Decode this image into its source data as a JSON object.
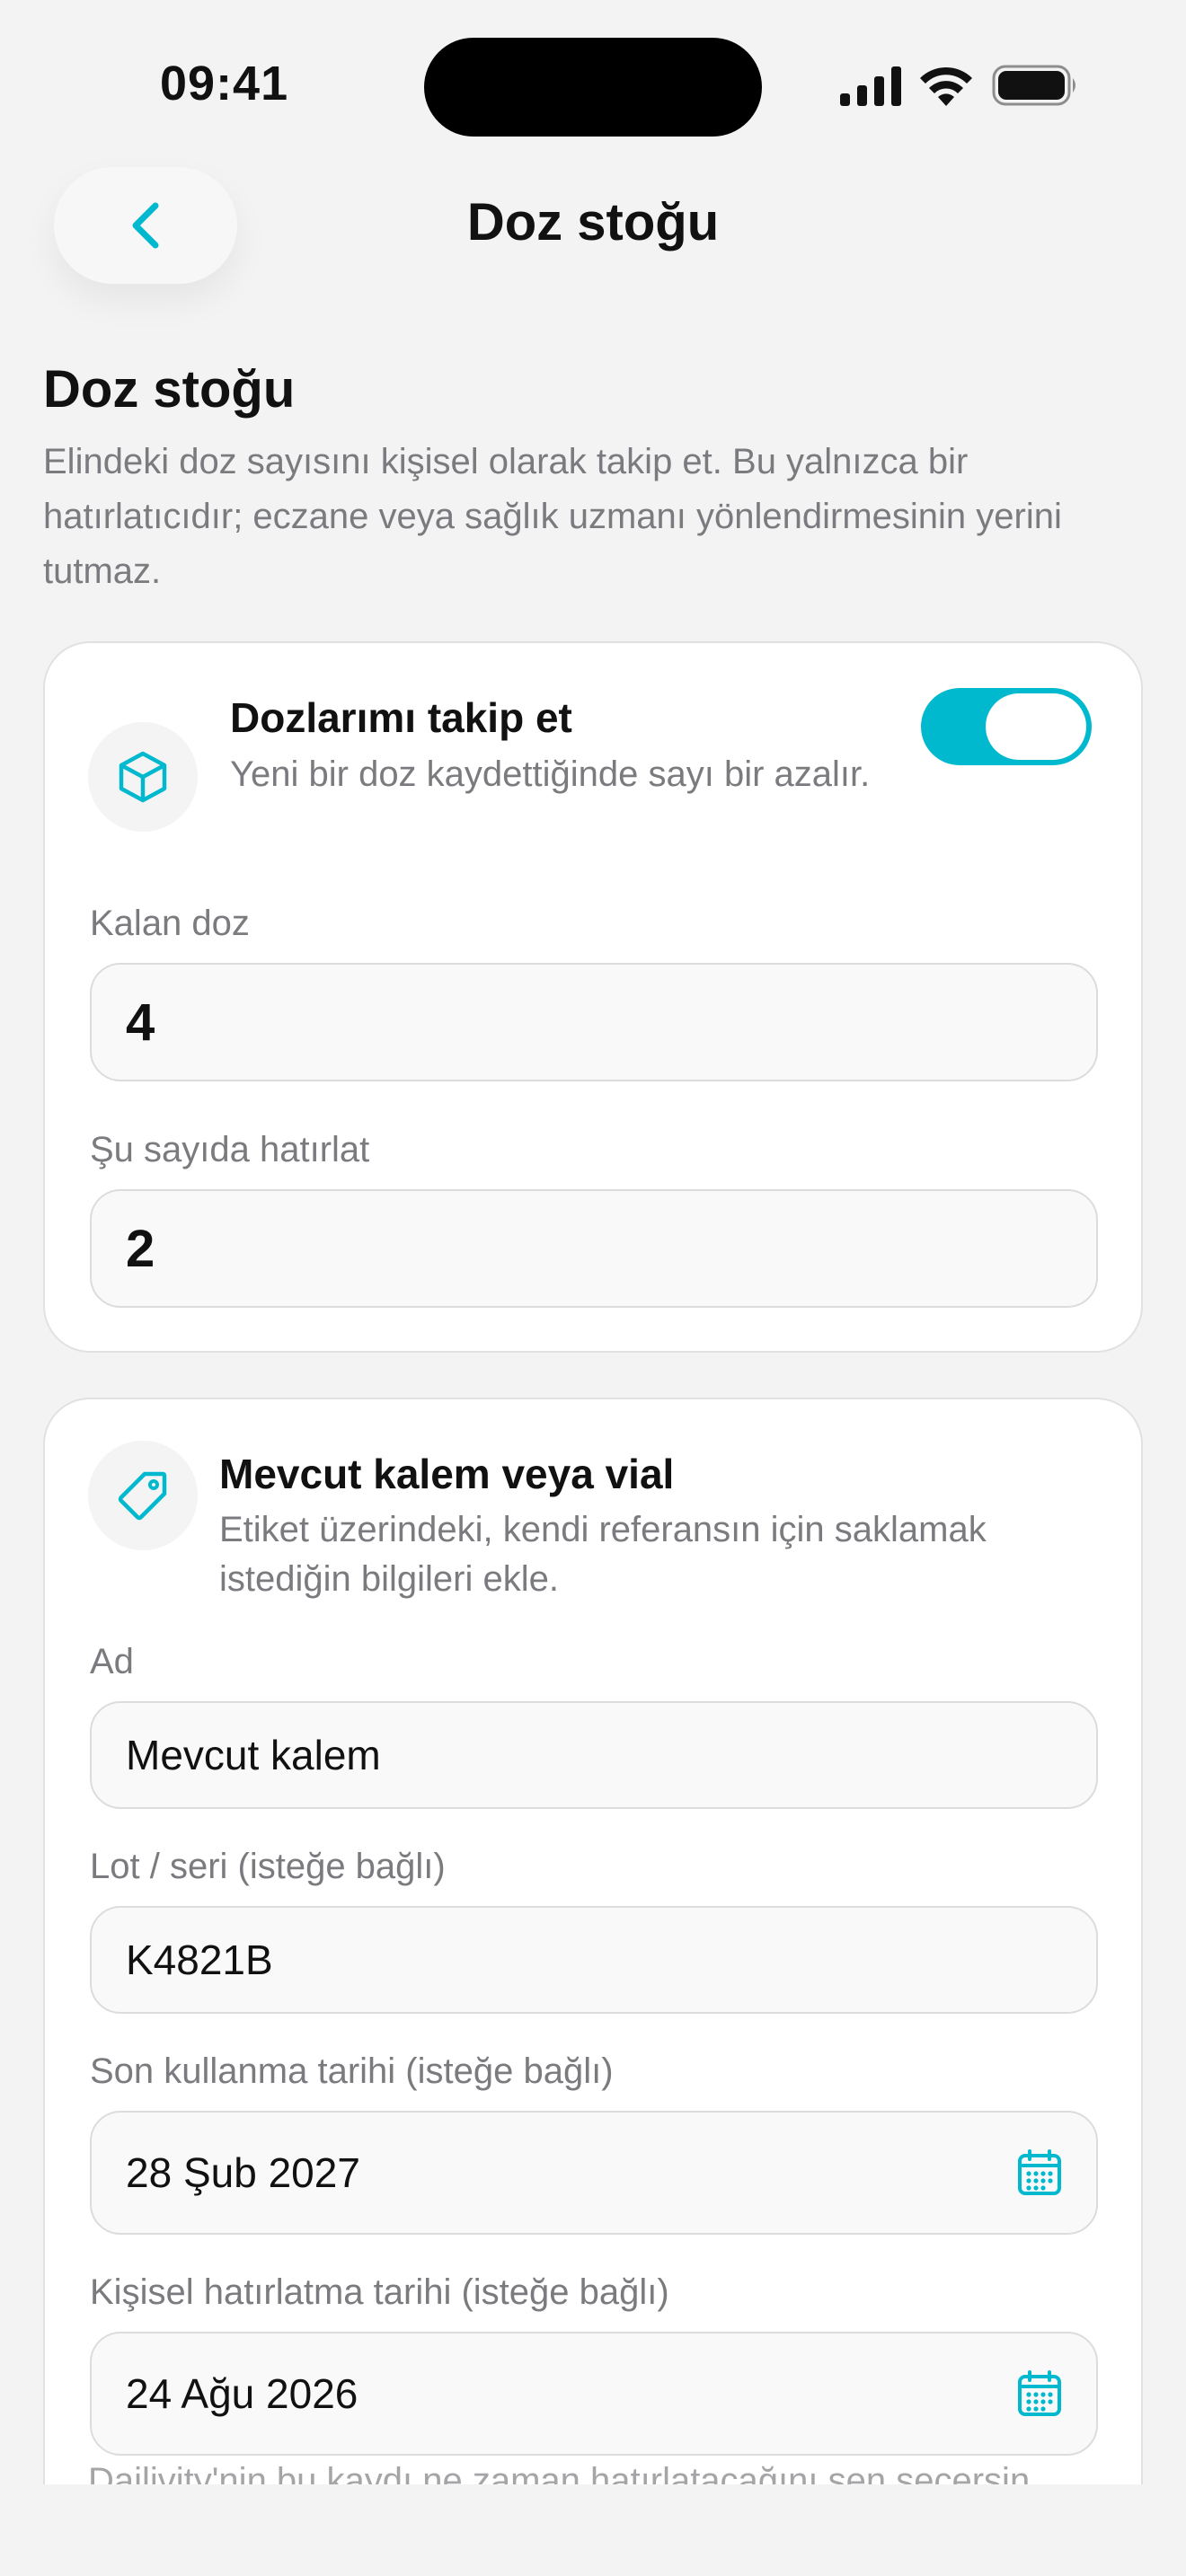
{
  "status_bar": {
    "time": "09:41"
  },
  "nav": {
    "title": "Doz stoğu",
    "back_icon": "chevron-left-icon"
  },
  "header": {
    "title": "Doz stoğu",
    "description": "Elindeki doz sayısını kişisel olarak takip et. Bu yalnızca bir hatırlatıcıdır; eczane veya sağlık uzmanı yönlendirmesinin yerini tutmaz."
  },
  "tracking_card": {
    "icon": "cube-icon",
    "title": "Dozlarımı takip et",
    "subtitle": "Yeni bir doz kaydettiğinde sayı bir azalır.",
    "toggle_on": true,
    "remaining_label": "Kalan doz",
    "remaining_value": "4",
    "remind_label": "Şu sayıda hatırlat",
    "remind_value": "2"
  },
  "pen_card": {
    "icon": "tag-icon",
    "title": "Mevcut kalem veya vial",
    "subtitle": "Etiket üzerindeki, kendi referansın için saklamak istediğin bilgileri ekle.",
    "name_label": "Ad",
    "name_value": "Mevcut kalem",
    "lot_label": "Lot / seri (isteğe bağlı)",
    "lot_value": "K4821B",
    "expiry_label": "Son kullanma tarihi (isteğe bağlı)",
    "expiry_value": "28 Şub 2027",
    "reminder_label": "Kişisel hatırlatma tarihi (isteğe bağlı)",
    "reminder_value": "24 Ağu 2026",
    "footer_hint": "Dailivity'nin bu kaydı ne zaman hatırlatacağını sen seçersin."
  },
  "colors": {
    "accent": "#00b9cf",
    "background": "#f3f3f4",
    "card": "#ffffff",
    "muted_text": "#7b7b7f"
  }
}
